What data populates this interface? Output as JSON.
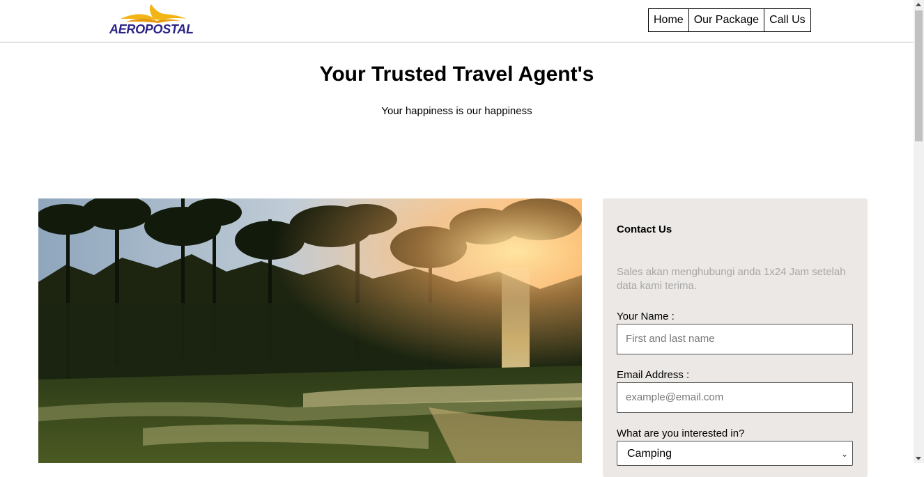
{
  "brand": {
    "name": "AEROPOSTAL",
    "logo_color": "#2a2388",
    "wing_color": "#f2b515"
  },
  "nav": {
    "items": [
      {
        "label": "Home"
      },
      {
        "label": "Our Package"
      },
      {
        "label": "Call Us"
      }
    ]
  },
  "hero": {
    "title": "Your Trusted Travel Agent's",
    "subtitle": "Your happiness is our happiness"
  },
  "contact": {
    "title": "Contact Us",
    "description": "Sales akan menghubungi anda 1x24 Jam setelah data kami terima.",
    "name_label": "Your Name :",
    "name_placeholder": "First and last name",
    "email_label": "Email Address :",
    "email_placeholder": "example@email.com",
    "interest_label": "What are you interested in?",
    "interest_selected": "Camping",
    "card_bg": "#ebe8e5"
  }
}
